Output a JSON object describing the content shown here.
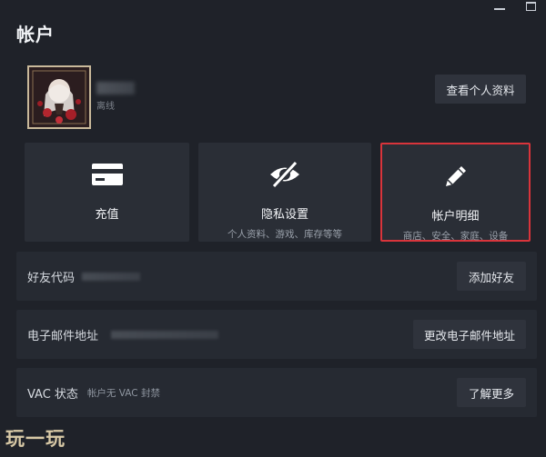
{
  "window": {
    "minimize_icon": "minimize-icon",
    "maximize_icon": "maximize-icon"
  },
  "header": {
    "title": "帐户"
  },
  "profile": {
    "status": "离线",
    "view_profile_label": "查看个人资料"
  },
  "cards": [
    {
      "icon": "card-icon",
      "title": "充值",
      "subtitle": ""
    },
    {
      "icon": "eye-slash-icon",
      "title": "隐私设置",
      "subtitle": "个人资料、游戏、库存等等"
    },
    {
      "icon": "pencil-icon",
      "title": "帐户明细",
      "subtitle": "商店、安全、家庭、设备",
      "highlight_color": "#d9343b"
    }
  ],
  "rows": {
    "friend_code": {
      "label": "好友代码",
      "button": "添加好友"
    },
    "email": {
      "label": "电子邮件地址",
      "button": "更改电子邮件地址"
    },
    "vac": {
      "label": "VAC 状态",
      "value": "帐户无 VAC 封禁",
      "button": "了解更多"
    }
  },
  "watermark": "玩一玩",
  "colors": {
    "background": "#1f2229",
    "card": "#2a2e36",
    "button": "#2f333c",
    "highlight": "#d9343b"
  }
}
